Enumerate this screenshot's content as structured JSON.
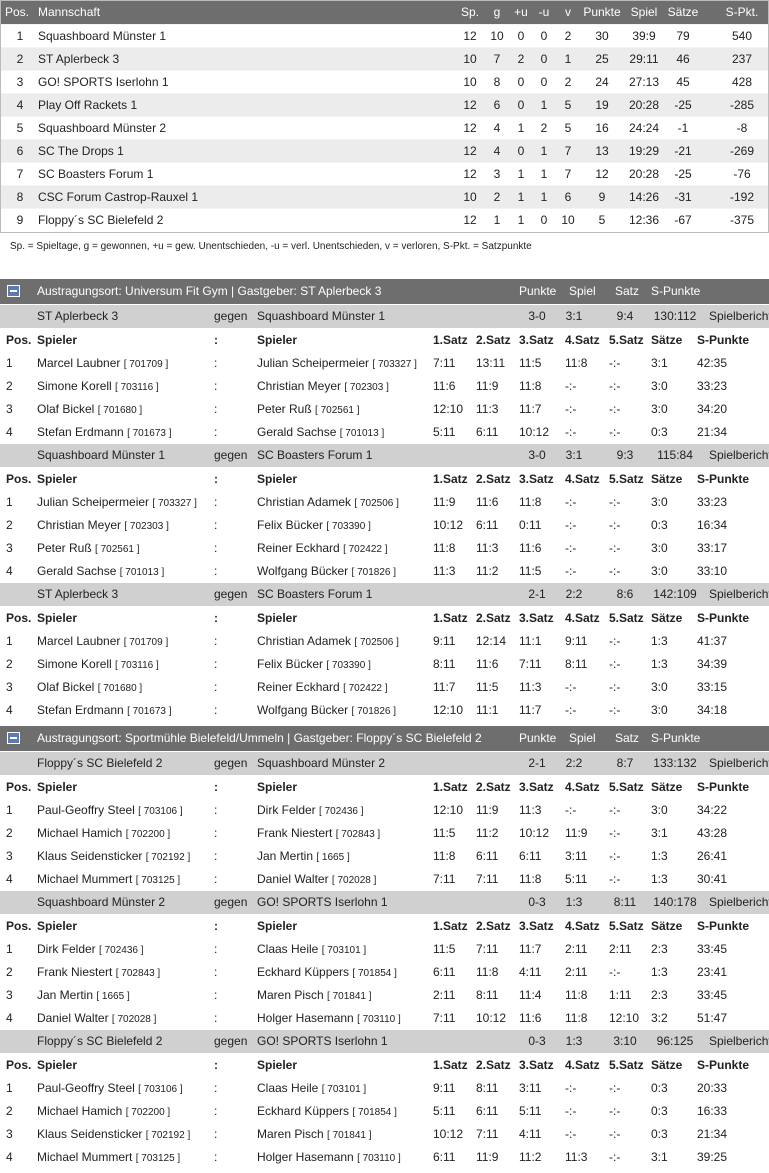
{
  "standings": {
    "headers": {
      "pos": "Pos.",
      "team": "Mannschaft",
      "sp": "Sp.",
      "g": "g",
      "pu": "+u",
      "mu": "-u",
      "v": "v",
      "punkte": "Punkte",
      "spiel": "Spiel",
      "saetze": "Sätze",
      "spkt": "S-Pkt."
    },
    "rows": [
      {
        "pos": "1",
        "team": "Squashboard Münster 1",
        "sp": "12",
        "g": "10",
        "pu": "0",
        "mu": "0",
        "v": "2",
        "punkte": "30",
        "spiel": "39:9",
        "saetze": "79",
        "spkt": "540"
      },
      {
        "pos": "2",
        "team": "ST Aplerbeck 3",
        "sp": "10",
        "g": "7",
        "pu": "2",
        "mu": "0",
        "v": "1",
        "punkte": "25",
        "spiel": "29:11",
        "saetze": "46",
        "spkt": "237"
      },
      {
        "pos": "3",
        "team": "GO! SPORTS Iserlohn 1",
        "sp": "10",
        "g": "8",
        "pu": "0",
        "mu": "0",
        "v": "2",
        "punkte": "24",
        "spiel": "27:13",
        "saetze": "45",
        "spkt": "428"
      },
      {
        "pos": "4",
        "team": "Play Off Rackets 1",
        "sp": "12",
        "g": "6",
        "pu": "0",
        "mu": "1",
        "v": "5",
        "punkte": "19",
        "spiel": "20:28",
        "saetze": "-25",
        "spkt": "-285"
      },
      {
        "pos": "5",
        "team": "Squashboard Münster 2",
        "sp": "12",
        "g": "4",
        "pu": "1",
        "mu": "2",
        "v": "5",
        "punkte": "16",
        "spiel": "24:24",
        "saetze": "-1",
        "spkt": "-8"
      },
      {
        "pos": "6",
        "team": "SC The Drops 1",
        "sp": "12",
        "g": "4",
        "pu": "0",
        "mu": "1",
        "v": "7",
        "punkte": "13",
        "spiel": "19:29",
        "saetze": "-21",
        "spkt": "-269"
      },
      {
        "pos": "7",
        "team": "SC Boasters Forum 1",
        "sp": "12",
        "g": "3",
        "pu": "1",
        "mu": "1",
        "v": "7",
        "punkte": "12",
        "spiel": "20:28",
        "saetze": "-25",
        "spkt": "-76"
      },
      {
        "pos": "8",
        "team": "CSC Forum Castrop-Rauxel 1",
        "sp": "10",
        "g": "2",
        "pu": "1",
        "mu": "1",
        "v": "6",
        "punkte": "9",
        "spiel": "14:26",
        "saetze": "-31",
        "spkt": "-192"
      },
      {
        "pos": "9",
        "team": "Floppy´s SC Bielefeld 2",
        "sp": "12",
        "g": "1",
        "pu": "1",
        "mu": "0",
        "v": "10",
        "punkte": "5",
        "spiel": "12:36",
        "saetze": "-67",
        "spkt": "-375"
      }
    ],
    "legend": "Sp. = Spieltage, g = gewonnen, +u = gew. Unentschieden, -u = verl. Unentschieden, v = verloren, S-Pkt. = Satzpunkte"
  },
  "labels": {
    "vs": "gegen",
    "report": "Spielbericht",
    "col_pos": "Pos.",
    "col_player": "Spieler",
    "col_colon": ":",
    "col_s1": "1.Satz",
    "col_s2": "2.Satz",
    "col_s3": "3.Satz",
    "col_s4": "4.Satz",
    "col_s5": "5.Satz",
    "col_saetze": "Sätze",
    "col_spunkte": "S-Punkte",
    "venue_punkte": "Punkte",
    "venue_spiel": "Spiel",
    "venue_satz": "Satz",
    "venue_spunkte": "S-Punkte",
    "colon": ":"
  },
  "venues": [
    {
      "title": "Austragungsort: Universum Fit Gym  |  Gastgeber: ST Aplerbeck 3",
      "matches": [
        {
          "home": "ST Aplerbeck 3",
          "away": "Squashboard Münster 1",
          "punkte": "3-0",
          "spiel": "3:1",
          "satz": "9:4",
          "spunkte": "130:112",
          "games": [
            {
              "pos": "1",
              "p1": "Marcel Laubner",
              "id1": "[ 701709 ]",
              "p2": "Julian Scheipermeier",
              "id2": "[ 703327 ]",
              "s": [
                "7:11",
                "13:11",
                "11:5",
                "11:8",
                "-:-"
              ],
              "saetze": "3:1",
              "spunkte": "42:35"
            },
            {
              "pos": "2",
              "p1": "Simone Korell",
              "id1": "[ 703116 ]",
              "p2": "Christian Meyer",
              "id2": "[ 702303 ]",
              "s": [
                "11:6",
                "11:9",
                "11:8",
                "-:-",
                "-:-"
              ],
              "saetze": "3:0",
              "spunkte": "33:23"
            },
            {
              "pos": "3",
              "p1": "Olaf Bickel",
              "id1": "[ 701680 ]",
              "p2": "Peter Ruß",
              "id2": "[ 702561 ]",
              "s": [
                "12:10",
                "11:3",
                "11:7",
                "-:-",
                "-:-"
              ],
              "saetze": "3:0",
              "spunkte": "34:20"
            },
            {
              "pos": "4",
              "p1": "Stefan Erdmann",
              "id1": "[ 701673 ]",
              "p2": "Gerald Sachse",
              "id2": "[ 701013 ]",
              "s": [
                "5:11",
                "6:11",
                "10:12",
                "-:-",
                "-:-"
              ],
              "saetze": "0:3",
              "spunkte": "21:34"
            }
          ]
        },
        {
          "home": "Squashboard Münster 1",
          "away": "SC Boasters Forum 1",
          "punkte": "3-0",
          "spiel": "3:1",
          "satz": "9:3",
          "spunkte": "115:84",
          "games": [
            {
              "pos": "1",
              "p1": "Julian Scheipermeier",
              "id1": "[ 703327 ]",
              "p2": "Christian Adamek",
              "id2": "[ 702506 ]",
              "s": [
                "11:9",
                "11:6",
                "11:8",
                "-:-",
                "-:-"
              ],
              "saetze": "3:0",
              "spunkte": "33:23"
            },
            {
              "pos": "2",
              "p1": "Christian Meyer",
              "id1": "[ 702303 ]",
              "p2": "Felix Bücker",
              "id2": "[ 703390 ]",
              "s": [
                "10:12",
                "6:11",
                "0:11",
                "-:-",
                "-:-"
              ],
              "saetze": "0:3",
              "spunkte": "16:34"
            },
            {
              "pos": "3",
              "p1": "Peter Ruß",
              "id1": "[ 702561 ]",
              "p2": "Reiner Eckhard",
              "id2": "[ 702422 ]",
              "s": [
                "11:8",
                "11:3",
                "11:6",
                "-:-",
                "-:-"
              ],
              "saetze": "3:0",
              "spunkte": "33:17"
            },
            {
              "pos": "4",
              "p1": "Gerald Sachse",
              "id1": "[ 701013 ]",
              "p2": "Wolfgang Bücker",
              "id2": "[ 701826 ]",
              "s": [
                "11:3",
                "11:2",
                "11:5",
                "-:-",
                "-:-"
              ],
              "saetze": "3:0",
              "spunkte": "33:10"
            }
          ]
        },
        {
          "home": "ST Aplerbeck 3",
          "away": "SC Boasters Forum 1",
          "punkte": "2-1",
          "spiel": "2:2",
          "satz": "8:6",
          "spunkte": "142:109",
          "games": [
            {
              "pos": "1",
              "p1": "Marcel Laubner",
              "id1": "[ 701709 ]",
              "p2": "Christian Adamek",
              "id2": "[ 702506 ]",
              "s": [
                "9:11",
                "12:14",
                "11:1",
                "9:11",
                "-:-"
              ],
              "saetze": "1:3",
              "spunkte": "41:37"
            },
            {
              "pos": "2",
              "p1": "Simone Korell",
              "id1": "[ 703116 ]",
              "p2": "Felix Bücker",
              "id2": "[ 703390 ]",
              "s": [
                "8:11",
                "11:6",
                "7:11",
                "8:11",
                "-:-"
              ],
              "saetze": "1:3",
              "spunkte": "34:39"
            },
            {
              "pos": "3",
              "p1": "Olaf Bickel",
              "id1": "[ 701680 ]",
              "p2": "Reiner Eckhard",
              "id2": "[ 702422 ]",
              "s": [
                "11:7",
                "11:5",
                "11:3",
                "-:-",
                "-:-"
              ],
              "saetze": "3:0",
              "spunkte": "33:15"
            },
            {
              "pos": "4",
              "p1": "Stefan Erdmann",
              "id1": "[ 701673 ]",
              "p2": "Wolfgang Bücker",
              "id2": "[ 701826 ]",
              "s": [
                "12:10",
                "11:1",
                "11:7",
                "-:-",
                "-:-"
              ],
              "saetze": "3:0",
              "spunkte": "34:18"
            }
          ]
        }
      ]
    },
    {
      "title": "Austragungsort: Sportmühle Bielefeld/Ummeln  |  Gastgeber: Floppy´s SC Bielefeld 2",
      "matches": [
        {
          "home": "Floppy´s SC Bielefeld 2",
          "away": "Squashboard Münster 2",
          "punkte": "2-1",
          "spiel": "2:2",
          "satz": "8:7",
          "spunkte": "133:132",
          "games": [
            {
              "pos": "1",
              "p1": "Paul-Geoffry Steel",
              "id1": "[ 703106 ]",
              "p2": "Dirk Felder",
              "id2": "[ 702436 ]",
              "s": [
                "12:10",
                "11:9",
                "11:3",
                "-:-",
                "-:-"
              ],
              "saetze": "3:0",
              "spunkte": "34:22"
            },
            {
              "pos": "2",
              "p1": "Michael Hamich",
              "id1": "[ 702200 ]",
              "p2": "Frank Niestert",
              "id2": "[ 702843 ]",
              "s": [
                "11:5",
                "11:2",
                "10:12",
                "11:9",
                "-:-"
              ],
              "saetze": "3:1",
              "spunkte": "43:28"
            },
            {
              "pos": "3",
              "p1": "Klaus Seidensticker",
              "id1": "[ 702192 ]",
              "p2": "Jan Mertin",
              "id2": "[ 1665 ]",
              "s": [
                "11:8",
                "6:11",
                "6:11",
                "3:11",
                "-:-"
              ],
              "saetze": "1:3",
              "spunkte": "26:41"
            },
            {
              "pos": "4",
              "p1": "Michael Mummert",
              "id1": "[ 703125 ]",
              "p2": "Daniel Walter",
              "id2": "[ 702028 ]",
              "s": [
                "7:11",
                "7:11",
                "11:8",
                "5:11",
                "-:-"
              ],
              "saetze": "1:3",
              "spunkte": "30:41"
            }
          ]
        },
        {
          "home": "Squashboard Münster 2",
          "away": "GO! SPORTS Iserlohn 1",
          "punkte": "0-3",
          "spiel": "1:3",
          "satz": "8:11",
          "spunkte": "140:178",
          "games": [
            {
              "pos": "1",
              "p1": "Dirk Felder",
              "id1": "[ 702436 ]",
              "p2": "Claas Heile",
              "id2": "[ 703101 ]",
              "s": [
                "11:5",
                "7:11",
                "11:7",
                "2:11",
                "2:11"
              ],
              "saetze": "2:3",
              "spunkte": "33:45"
            },
            {
              "pos": "2",
              "p1": "Frank Niestert",
              "id1": "[ 702843 ]",
              "p2": "Eckhard Küppers",
              "id2": "[ 701854 ]",
              "s": [
                "6:11",
                "11:8",
                "4:11",
                "2:11",
                "-:-"
              ],
              "saetze": "1:3",
              "spunkte": "23:41"
            },
            {
              "pos": "3",
              "p1": "Jan Mertin",
              "id1": "[ 1665 ]",
              "p2": "Maren Pisch",
              "id2": "[ 701841 ]",
              "s": [
                "2:11",
                "8:11",
                "11:4",
                "11:8",
                "1:11"
              ],
              "saetze": "2:3",
              "spunkte": "33:45"
            },
            {
              "pos": "4",
              "p1": "Daniel Walter",
              "id1": "[ 702028 ]",
              "p2": "Holger Hasemann",
              "id2": "[ 703110 ]",
              "s": [
                "7:11",
                "10:12",
                "11:6",
                "11:8",
                "12:10"
              ],
              "saetze": "3:2",
              "spunkte": "51:47"
            }
          ]
        },
        {
          "home": "Floppy´s SC Bielefeld 2",
          "away": "GO! SPORTS Iserlohn 1",
          "punkte": "0-3",
          "spiel": "1:3",
          "satz": "3:10",
          "spunkte": "96:125",
          "games": [
            {
              "pos": "1",
              "p1": "Paul-Geoffry Steel",
              "id1": "[ 703106 ]",
              "p2": "Claas Heile",
              "id2": "[ 703101 ]",
              "s": [
                "9:11",
                "8:11",
                "3:11",
                "-:-",
                "-:-"
              ],
              "saetze": "0:3",
              "spunkte": "20:33"
            },
            {
              "pos": "2",
              "p1": "Michael Hamich",
              "id1": "[ 702200 ]",
              "p2": "Eckhard Küppers",
              "id2": "[ 701854 ]",
              "s": [
                "5:11",
                "6:11",
                "5:11",
                "-:-",
                "-:-"
              ],
              "saetze": "0:3",
              "spunkte": "16:33"
            },
            {
              "pos": "3",
              "p1": "Klaus Seidensticker",
              "id1": "[ 702192 ]",
              "p2": "Maren Pisch",
              "id2": "[ 701841 ]",
              "s": [
                "10:12",
                "7:11",
                "4:11",
                "-:-",
                "-:-"
              ],
              "saetze": "0:3",
              "spunkte": "21:34"
            },
            {
              "pos": "4",
              "p1": "Michael Mummert",
              "id1": "[ 703125 ]",
              "p2": "Holger Hasemann",
              "id2": "[ 703110 ]",
              "s": [
                "6:11",
                "11:9",
                "11:2",
                "11:3",
                "-:-"
              ],
              "saetze": "3:1",
              "spunkte": "39:25"
            }
          ]
        }
      ]
    }
  ]
}
